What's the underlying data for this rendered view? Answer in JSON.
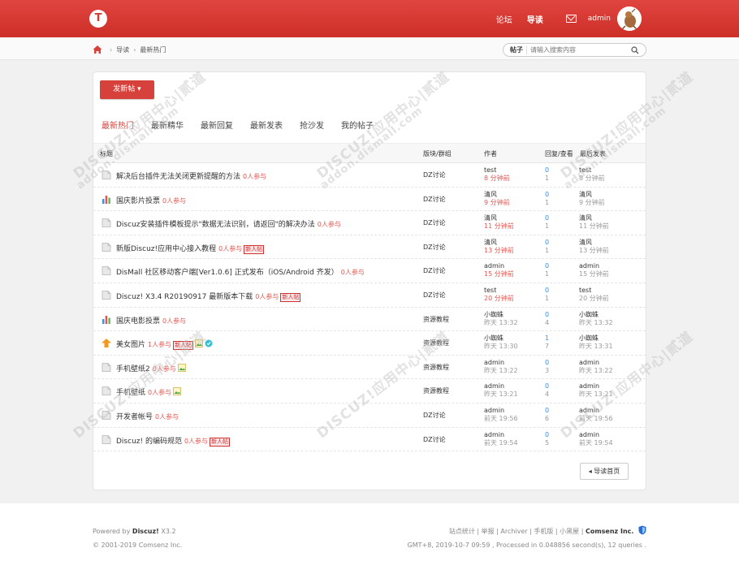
{
  "header": {
    "logo": "T",
    "nav": [
      {
        "label": "论坛",
        "active": false
      },
      {
        "label": "导读",
        "active": true
      }
    ],
    "username": "admin",
    "accent_color": "#d6413b"
  },
  "breadcrumb": {
    "sep": "›",
    "items": [
      "导读",
      "最新热门"
    ]
  },
  "search": {
    "scope": "帖子",
    "placeholder": "请输入搜索内容"
  },
  "toolbar": {
    "post_label": "发新帖 ▾"
  },
  "tabs": [
    "最新热门",
    "最新精华",
    "最新回复",
    "最新发表",
    "抢沙发",
    "我的帖子"
  ],
  "table": {
    "headers": {
      "title": "标题",
      "forum": "版块/群组",
      "author": "作者",
      "stats": "回复/查看",
      "last": "最后发表"
    },
    "rows": [
      {
        "icon": "doc-icon",
        "title": "解决后台插件无法关闭更新提醒的方法",
        "count": "0人参与",
        "badges": [],
        "forum": "DZ讨论",
        "author": "test",
        "time": "8 分钟前",
        "recent": true,
        "replies": "0",
        "views": "1",
        "last_user": "test",
        "last_time": "8 分钟前"
      },
      {
        "icon": "poll-icon",
        "title": "国庆影片投票",
        "count": "0人参与",
        "badges": [],
        "forum": "DZ讨论",
        "author": "清风",
        "time": "9 分钟前",
        "recent": true,
        "replies": "0",
        "views": "1",
        "last_user": "清风",
        "last_time": "9 分钟前"
      },
      {
        "icon": "doc-icon",
        "title": "Discuz安装插件模板提示\"数据无法识别，请返回\"的解决办法",
        "count": "0人参与",
        "badges": [],
        "forum": "DZ讨论",
        "author": "清风",
        "time": "11 分钟前",
        "recent": true,
        "replies": "0",
        "views": "1",
        "last_user": "清风",
        "last_time": "11 分钟前"
      },
      {
        "icon": "doc-icon",
        "title": "新版Discuz!应用中心接入教程",
        "count": "0人参与",
        "badges": [
          "新人帖"
        ],
        "forum": "DZ讨论",
        "author": "清风",
        "time": "13 分钟前",
        "recent": true,
        "replies": "0",
        "views": "1",
        "last_user": "清风",
        "last_time": "13 分钟前"
      },
      {
        "icon": "doc-icon",
        "title": "DisMall 社区移动客户端[Ver1.0.6] 正式发布（iOS/Android 齐发）",
        "count": "0人参与",
        "badges": [],
        "forum": "DZ讨论",
        "author": "admin",
        "time": "15 分钟前",
        "recent": true,
        "replies": "0",
        "views": "1",
        "last_user": "admin",
        "last_time": "15 分钟前"
      },
      {
        "icon": "doc-icon",
        "title": "Discuz! X3.4 R20190917 最新版本下载",
        "count": "0人参与",
        "badges": [
          "新人帖"
        ],
        "forum": "DZ讨论",
        "author": "test",
        "time": "20 分钟前",
        "recent": true,
        "replies": "0",
        "views": "1",
        "last_user": "test",
        "last_time": "20 分钟前"
      },
      {
        "icon": "poll-icon",
        "title": "国庆电影投票",
        "count": "0人参与",
        "badges": [],
        "forum": "资源教程",
        "author": "小蜘蛛",
        "time": "昨天 13:32",
        "recent": false,
        "replies": "0",
        "views": "4",
        "last_user": "小蜘蛛",
        "last_time": "昨天 13:32"
      },
      {
        "icon": "hot-icon",
        "title": "美女图片",
        "count": "1人参与",
        "badges": [
          "新人帖",
          "img",
          "vip"
        ],
        "forum": "资源教程",
        "author": "小蜘蛛",
        "time": "昨天 13:30",
        "recent": false,
        "replies": "1",
        "views": "7",
        "last_user": "小蜘蛛",
        "last_time": "昨天 13:31"
      },
      {
        "icon": "doc-icon",
        "title": "手机壁纸2",
        "count": "0人参与",
        "badges": [
          "img"
        ],
        "forum": "资源教程",
        "author": "admin",
        "time": "昨天 13:22",
        "recent": false,
        "replies": "0",
        "views": "3",
        "last_user": "admin",
        "last_time": "昨天 13:22"
      },
      {
        "icon": "doc-icon",
        "title": "手机壁纸",
        "count": "0人参与",
        "badges": [
          "img"
        ],
        "forum": "资源教程",
        "author": "admin",
        "time": "昨天 13:21",
        "recent": false,
        "replies": "0",
        "views": "4",
        "last_user": "admin",
        "last_time": "昨天 13:21"
      },
      {
        "icon": "doc-icon",
        "title": "开发者帐号",
        "count": "0人参与",
        "badges": [],
        "forum": "DZ讨论",
        "author": "admin",
        "time": "前天 19:56",
        "recent": false,
        "replies": "0",
        "views": "6",
        "last_user": "admin",
        "last_time": "前天 19:56"
      },
      {
        "icon": "doc-icon",
        "title": "Discuz! 的编码规范",
        "count": "0人参与",
        "badges": [
          "新人帖"
        ],
        "forum": "DZ讨论",
        "author": "admin",
        "time": "前天 19:54",
        "recent": false,
        "replies": "0",
        "views": "5",
        "last_user": "admin",
        "last_time": "前天 19:54"
      }
    ]
  },
  "back_label": "◂ 导读首页",
  "footer": {
    "powered": "Powered by ",
    "product": "Discuz!",
    "version": " X3.2",
    "copyright": "© 2001-2019 Comsenz Inc.",
    "links": "站点统计 | 举报 | Archiver | 手机版 | 小黑屋 | ",
    "company": "Comsenz Inc.",
    "stats": "GMT+8, 2019-10-7 09:59 , Processed in 0.048856 second(s), 12 queries ."
  },
  "watermark": {
    "line1": "DISCUZ!应用中心|贰道",
    "line2": "addon.dismall.com"
  }
}
